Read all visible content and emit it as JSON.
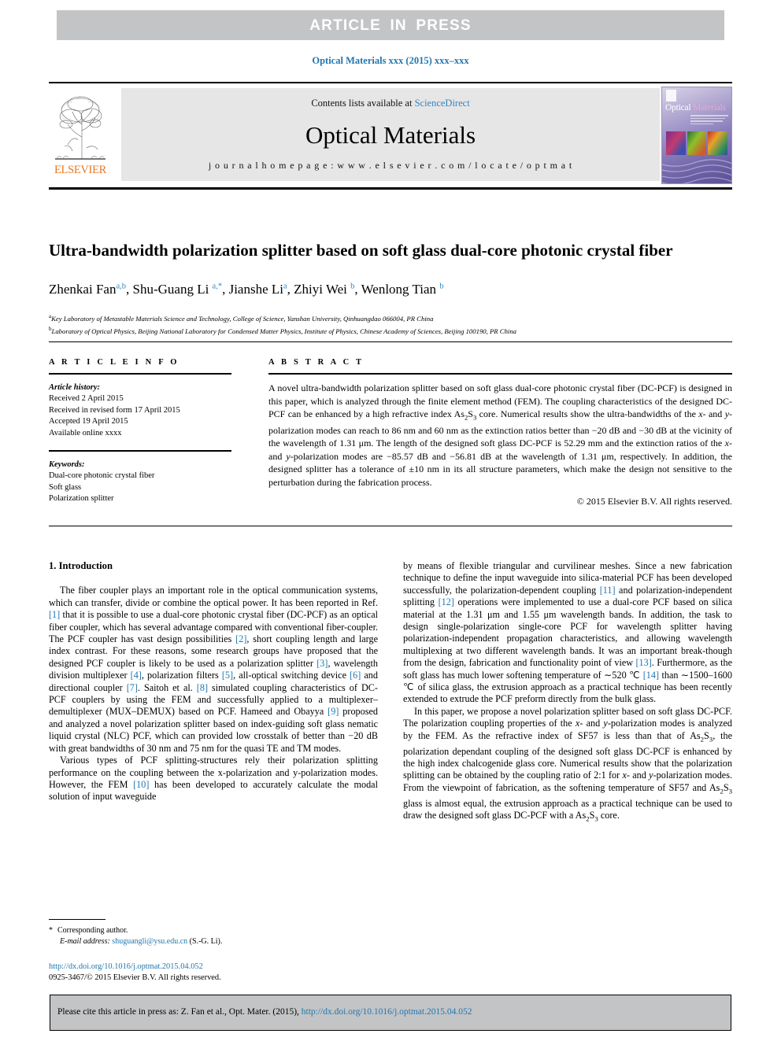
{
  "banner": {
    "text": "ARTICLE  IN  PRESS"
  },
  "running_head": "Optical Materials xxx (2015) xxx–xxx",
  "masthead": {
    "contents_prefix": "Contents lists available at ",
    "contents_link": "ScienceDirect",
    "journal_title": "Optical Materials",
    "homepage": "j o u r n a l   h o m e p a g e :   w w w . e l s e v i e r . c o m / l o c a t e / o p t m a t",
    "publisher": "ELSEVIER",
    "cover": {
      "title_part1": "Optical ",
      "title_part2": "Materials"
    }
  },
  "article": {
    "title": "Ultra-bandwidth polarization splitter based on soft glass dual-core photonic crystal fiber",
    "authors": [
      {
        "name": "Zhenkai Fan",
        "sup": "a,b",
        "sep": ", "
      },
      {
        "name": "Shu-Guang Li ",
        "sup": "a,*",
        "sep": ", "
      },
      {
        "name": "Jianshe Li",
        "sup": "a",
        "sep": ", "
      },
      {
        "name": "Zhiyi Wei ",
        "sup": "b",
        "sep": ", "
      },
      {
        "name": "Wenlong Tian ",
        "sup": "b",
        "sep": ""
      }
    ],
    "affiliations": [
      {
        "sup": "a",
        "text": "Key Laboratory of Metastable Materials Science and Technology, College of Science, Yanshan University, Qinhuangdao 066004, PR China"
      },
      {
        "sup": "b",
        "text": "Laboratory of Optical Physics, Beijing National Laboratory for Condensed Matter Physics, Institute of Physics, Chinese Academy of Sciences, Beijing 100190, PR China"
      }
    ]
  },
  "info": {
    "heading": "A R T I C L E   I N F O",
    "history_label": "Article history:",
    "history": [
      "Received 2 April 2015",
      "Received in revised form 17 April 2015",
      "Accepted 19 April 2015",
      "Available online xxxx"
    ],
    "keywords_label": "Keywords:",
    "keywords": [
      "Dual-core photonic crystal fiber",
      "Soft glass",
      "Polarization splitter"
    ]
  },
  "abstract": {
    "heading": "A B S T R A C T",
    "copyright": "© 2015 Elsevier B.V. All rights reserved."
  },
  "body": {
    "section_title": "1. Introduction"
  },
  "footnotes": {
    "corresponding": "Corresponding author.",
    "email_label": "E-mail address:",
    "email": "shuguangli@ysu.edu.cn",
    "email_owner": "(S.-G. Li).",
    "doi": "http://dx.doi.org/10.1016/j.optmat.2015.04.052",
    "issn_line": "0925-3467/© 2015 Elsevier B.V. All rights reserved."
  },
  "cite_bar": {
    "prefix": "Please cite this article in press as: Z. Fan et al., Opt. Mater. (2015), ",
    "link": "http://dx.doi.org/10.1016/j.optmat.2015.04.052"
  },
  "colors": {
    "link": "#2177b0",
    "banner_gray": "#c3c4c6",
    "masthead_gray": "#e6e6e6",
    "elsevier_orange": "#e87722"
  }
}
